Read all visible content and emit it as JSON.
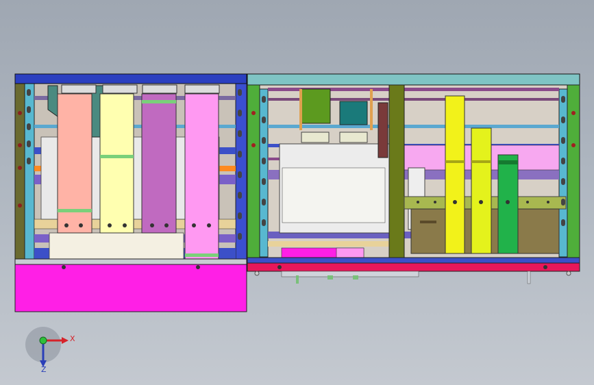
{
  "viewport": {
    "background_top": "#9fa7b2",
    "background_bottom": "#c4c9d0"
  },
  "axes_triad": {
    "x_label": "X",
    "z_label": "Z",
    "x_color": "#d6232a",
    "y_color": "#2fbf3a",
    "z_color": "#2a3fb8"
  },
  "left_enclosure": {
    "top_frame_color": "#2b3fc0",
    "bottom_panel_color": "#ff1fe6",
    "busbars": [
      {
        "name": "busbar-salmon",
        "color": "#ffb3a6"
      },
      {
        "name": "busbar-light-yellow",
        "color": "#ffffb0"
      },
      {
        "name": "busbar-purple",
        "color": "#c06ac0"
      },
      {
        "name": "busbar-pink",
        "color": "#ff99f2"
      }
    ]
  },
  "right_enclosure": {
    "top_frame_color": "#7fc4c4",
    "bottom_rail_color": "#e8175a",
    "side_frame_color": "#4fae3a",
    "busbars": [
      {
        "name": "busbar-yellow",
        "color": "#f2f21a"
      },
      {
        "name": "busbar-yellow-2",
        "color": "#e4f21c"
      },
      {
        "name": "busbar-green",
        "color": "#21b24a"
      }
    ]
  }
}
